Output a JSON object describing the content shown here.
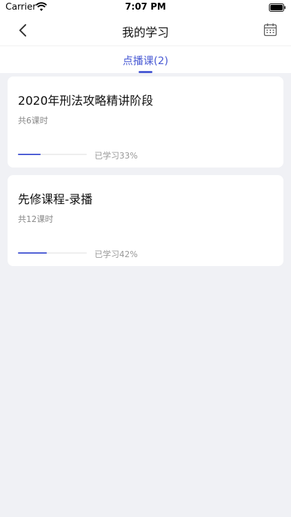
{
  "status_bar": {
    "carrier": "Carrier",
    "time": "7:07 PM",
    "wifi_icon": "wifi-icon",
    "battery_icon": "battery-full-icon"
  },
  "nav": {
    "title": "我的学习",
    "back_icon": "chevron-left-icon",
    "calendar_icon": "calendar-icon"
  },
  "tabs": [
    {
      "label": "点播课(2)",
      "active": true
    }
  ],
  "colors": {
    "accent": "#4a5bd4",
    "background": "#f0f1f5"
  },
  "courses": [
    {
      "title": "2020年刑法攻略精讲阶段",
      "lessons": "共6课时",
      "progress_label": "已学习33%",
      "progress": 0.33
    },
    {
      "title": "先修课程-录播",
      "lessons": "共12课时",
      "progress_label": "已学习42%",
      "progress": 0.42
    }
  ]
}
